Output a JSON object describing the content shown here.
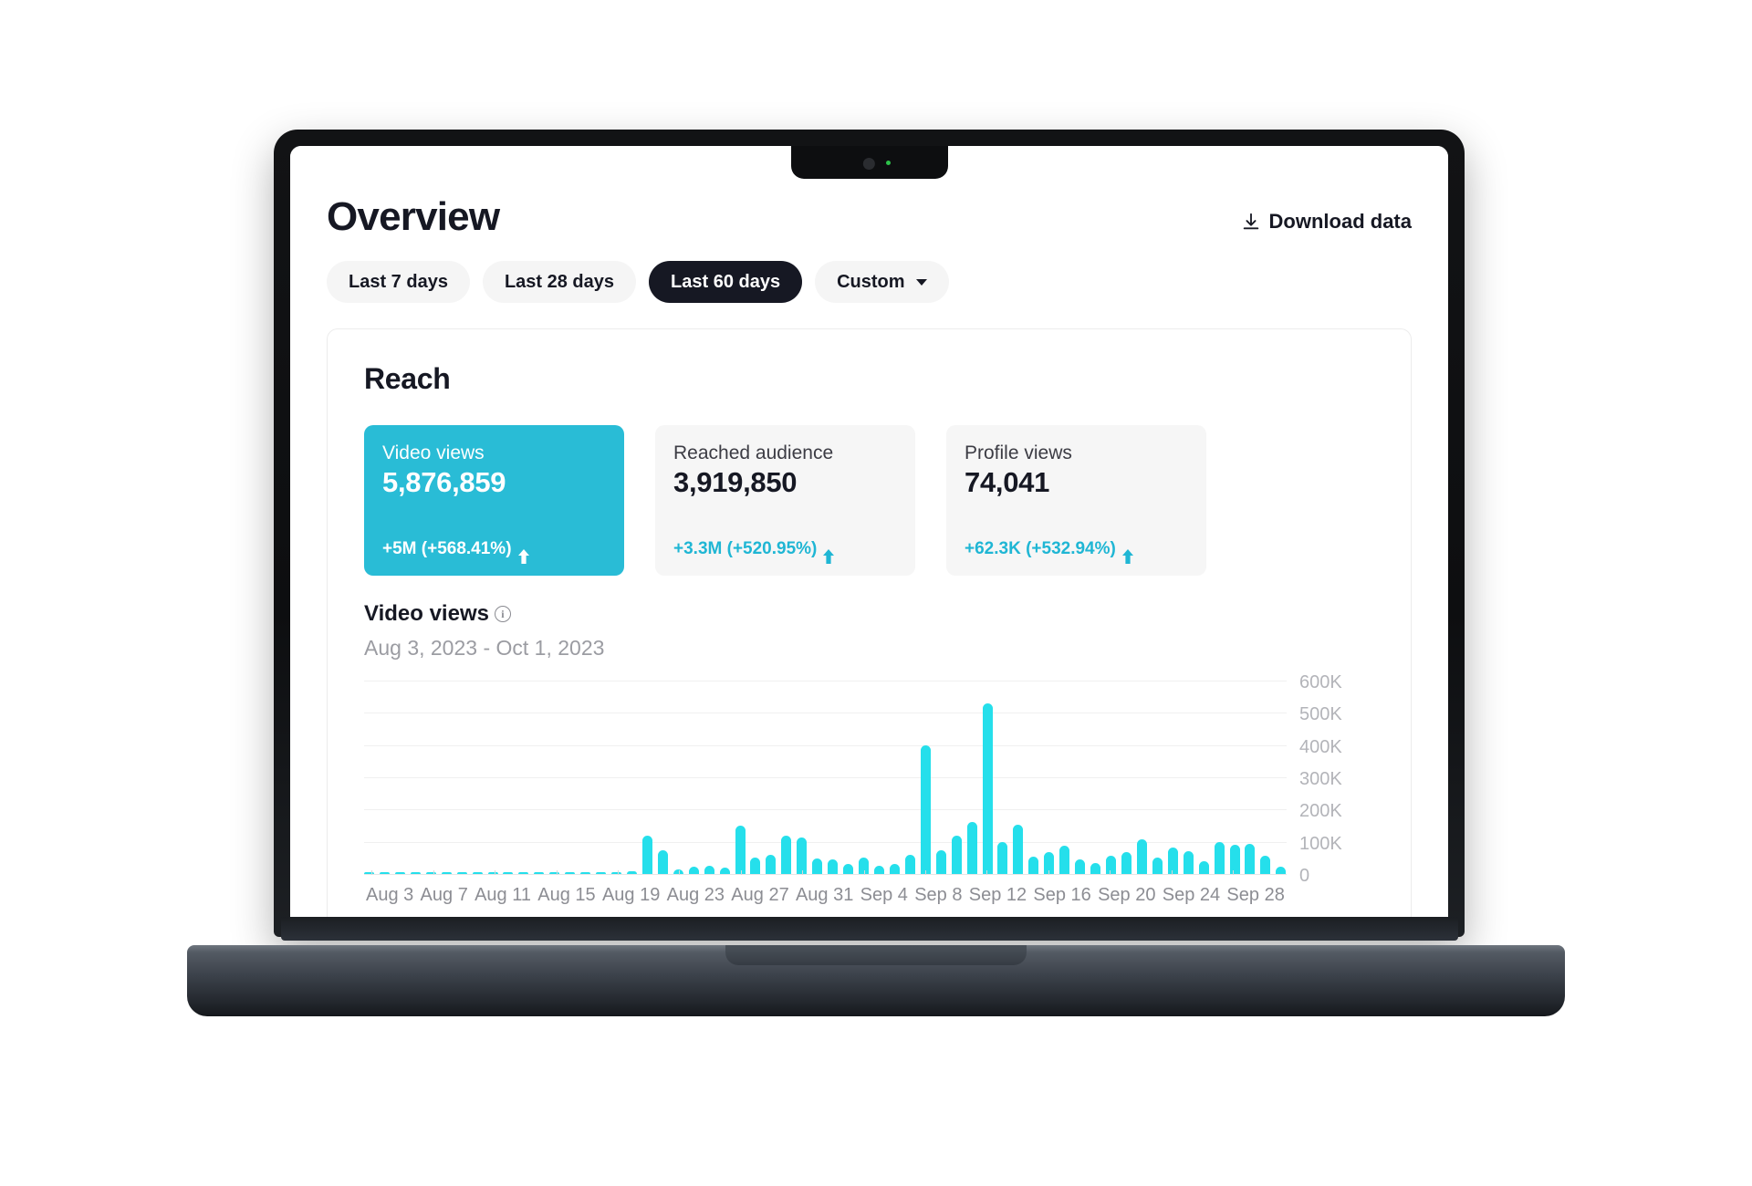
{
  "header": {
    "title": "Overview",
    "download_label": "Download data",
    "download_icon": "download-icon"
  },
  "filters": {
    "options": [
      {
        "label": "Last 7 days",
        "active": false
      },
      {
        "label": "Last 28 days",
        "active": false
      },
      {
        "label": "Last 60 days",
        "active": true
      },
      {
        "label": "Custom",
        "active": false,
        "icon": "chevron-down-icon"
      }
    ]
  },
  "reach": {
    "section_title": "Reach",
    "cards": [
      {
        "label": "Video views",
        "value": "5,876,859",
        "delta": "+5M  (+568.41%)",
        "trend_icon": "arrow-up-icon",
        "selected": true
      },
      {
        "label": "Reached audience",
        "value": "3,919,850",
        "delta": "+3.3M  (+520.95%)",
        "trend_icon": "arrow-up-icon",
        "selected": false
      },
      {
        "label": "Profile views",
        "value": "74,041",
        "delta": "+62.3K  (+532.94%)",
        "trend_icon": "arrow-up-icon",
        "selected": false
      }
    ]
  },
  "chart_header": {
    "title": "Video views",
    "info_icon": "info-icon",
    "info_glyph": "i",
    "date_range": "Aug 3, 2023 - Oct 1, 2023"
  },
  "colors": {
    "accent_bar": "#25dfeb",
    "card_selected": "#29bcd6",
    "delta_text": "#1fb6d4",
    "chip_active_bg": "#161823",
    "chip_bg": "#f5f5f5"
  },
  "chart_data": {
    "type": "bar",
    "title": "Video views",
    "subtitle": "Aug 3, 2023 - Oct 1, 2023",
    "xlabel": "",
    "ylabel": "",
    "ylim": [
      0,
      600000
    ],
    "grid": true,
    "legend": null,
    "yticks": [
      600000,
      500000,
      400000,
      300000,
      200000,
      100000,
      0
    ],
    "ytick_labels": [
      "600K",
      "500K",
      "400K",
      "300K",
      "200K",
      "100K",
      "0"
    ],
    "xtick_labels": [
      "Aug 3",
      "Aug 7",
      "Aug 11",
      "Aug 15",
      "Aug 19",
      "Aug 23",
      "Aug 27",
      "Aug 31",
      "Sep 4",
      "Sep 8",
      "Sep 12",
      "Sep 16",
      "Sep 20",
      "Sep 24",
      "Sep 28"
    ],
    "categories": [
      "Aug 3",
      "Aug 4",
      "Aug 5",
      "Aug 6",
      "Aug 7",
      "Aug 8",
      "Aug 9",
      "Aug 10",
      "Aug 11",
      "Aug 12",
      "Aug 13",
      "Aug 14",
      "Aug 15",
      "Aug 16",
      "Aug 17",
      "Aug 18",
      "Aug 19",
      "Aug 20",
      "Aug 21",
      "Aug 22",
      "Aug 23",
      "Aug 24",
      "Aug 25",
      "Aug 26",
      "Aug 27",
      "Aug 28",
      "Aug 29",
      "Aug 30",
      "Aug 31",
      "Sep 1",
      "Sep 2",
      "Sep 3",
      "Sep 4",
      "Sep 5",
      "Sep 6",
      "Sep 7",
      "Sep 8",
      "Sep 9",
      "Sep 10",
      "Sep 11",
      "Sep 12",
      "Sep 13",
      "Sep 14",
      "Sep 15",
      "Sep 16",
      "Sep 17",
      "Sep 18",
      "Sep 19",
      "Sep 20",
      "Sep 21",
      "Sep 22",
      "Sep 23",
      "Sep 24",
      "Sep 25",
      "Sep 26",
      "Sep 27",
      "Sep 28",
      "Sep 29",
      "Sep 30",
      "Oct 1"
    ],
    "values": [
      1000,
      800,
      900,
      1200,
      1000,
      1500,
      1200,
      1400,
      1600,
      1500,
      1800,
      2000,
      2500,
      2200,
      3000,
      2800,
      4000,
      9000,
      120000,
      75000,
      14000,
      22000,
      26000,
      19000,
      150000,
      52000,
      60000,
      118000,
      112000,
      47000,
      44000,
      31000,
      52000,
      26000,
      30000,
      60000,
      400000,
      74000,
      120000,
      160000,
      530000,
      98000,
      152000,
      55000,
      68000,
      88000,
      46000,
      34000,
      58000,
      68000,
      108000,
      52000,
      82000,
      72000,
      40000,
      98000,
      92000,
      94000,
      56000,
      22000
    ]
  }
}
